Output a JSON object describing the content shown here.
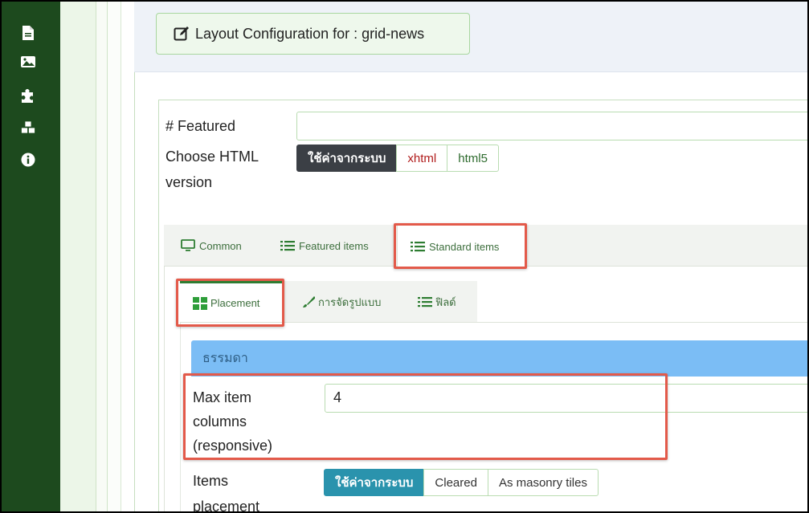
{
  "header": {
    "title": "Layout Configuration for : grid-news"
  },
  "sidebar": {
    "icons": [
      "file-icon",
      "image-icon",
      "puzzle-icon",
      "cubes-icon",
      "info-icon"
    ]
  },
  "form": {
    "featured_label": "# Featured",
    "featured_value": "",
    "html_version_label_line1": "Choose HTML",
    "html_version_label_line2": "version",
    "html_version_options": [
      "ใช้ค่าจากระบบ",
      "xhtml",
      "html5"
    ],
    "html_version_selected": "ใช้ค่าจากระบบ"
  },
  "tabs_main": {
    "common": "Common",
    "featured": "Featured items",
    "standard": "Standard items",
    "active": "Standard items"
  },
  "tabs_sub": {
    "placement": "Placement",
    "format": "การจัดรูปแบบ",
    "fields": "ฟิลด์",
    "active": "Placement"
  },
  "section": {
    "title": "ธรรมดา",
    "max_cols_label_l1": "Max item",
    "max_cols_label_l2": "columns",
    "max_cols_label_l3": "(responsive)",
    "max_cols_value": "4",
    "items_placement_label_l1": "Items",
    "items_placement_label_l2": "placement",
    "items_placement_options": [
      "ใช้ค่าจากระบบ",
      "Cleared",
      "As masonry tiles"
    ],
    "items_placement_selected": "ใช้ค่าจากระบบ"
  },
  "colors": {
    "sidebar": "#1d4a1e",
    "highlight": "#e35a4a",
    "section_bar": "#7bbdf5",
    "active_teal": "#2a93ad"
  }
}
